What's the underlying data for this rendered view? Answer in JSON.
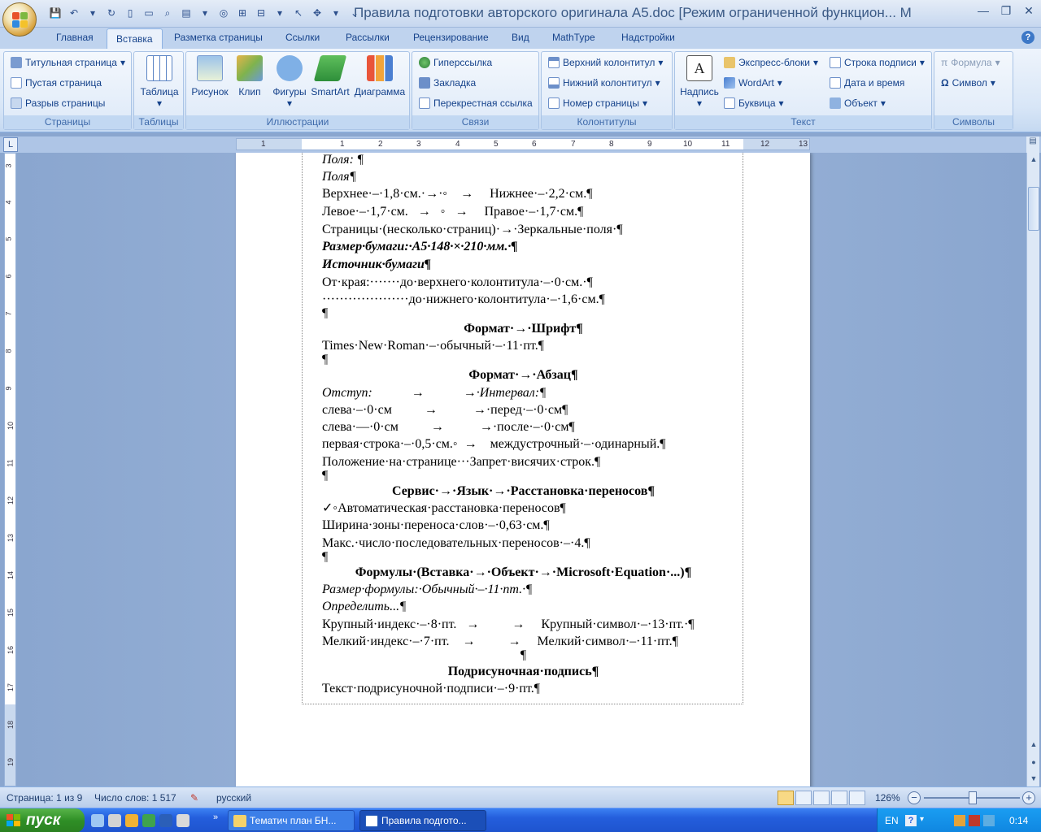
{
  "window": {
    "title": "Правила подготовки авторского оригинала A5.doc [Режим ограниченной функцион... M"
  },
  "tabs": [
    "Главная",
    "Вставка",
    "Разметка страницы",
    "Ссылки",
    "Рассылки",
    "Рецензирование",
    "Вид",
    "MathType",
    "Надстройки"
  ],
  "ribbon": {
    "pages": {
      "label": "Страницы",
      "items": [
        "Титульная страница",
        "Пустая страница",
        "Разрыв страницы"
      ]
    },
    "tables": {
      "label": "Таблицы",
      "table": "Таблица"
    },
    "illustrations": {
      "label": "Иллюстрации",
      "items": [
        "Рисунок",
        "Клип",
        "Фигуры",
        "SmartArt",
        "Диаграмма"
      ]
    },
    "links": {
      "label": "Связи",
      "items": [
        "Гиперссылка",
        "Закладка",
        "Перекрестная ссылка"
      ]
    },
    "header_footer": {
      "label": "Колонтитулы",
      "items": [
        "Верхний колонтитул",
        "Нижний колонтитул",
        "Номер страницы"
      ]
    },
    "text": {
      "label": "Текст",
      "textbox": "Надпись",
      "items": [
        "Экспресс-блоки",
        "WordArt",
        "Буквица",
        "Строка подписи",
        "Дата и время",
        "Объект"
      ]
    },
    "symbols": {
      "label": "Символы",
      "items": [
        "Формула",
        "Символ"
      ]
    }
  },
  "ruler_numbers": [
    "1",
    "1",
    "2",
    "3",
    "4",
    "5",
    "6",
    "7",
    "8",
    "9",
    "10",
    "11",
    "12",
    "13"
  ],
  "vruler_numbers": [
    "3",
    "4",
    "5",
    "6",
    "7",
    "8",
    "9",
    "10",
    "11",
    "12",
    "13",
    "14",
    "15",
    "16",
    "17",
    "18",
    "19"
  ],
  "document": {
    "lines": [
      "Поля: ¶",
      "Поля¶",
      "Верхнее·–·1,8·см.·→·◦    →     Нижнее·–·2,2·см.¶",
      "Левое·–·1,7·см.   →   ◦   →     Правое·–·1,7·см.¶",
      "Страницы·(несколько·страниц)·→·Зеркальные·поля·¶",
      "Размер·бумаги:·А5·148·×·210·мм.·¶",
      "Источник·бумаги¶",
      "От·края:·······до·верхнего·колонтитула·–·0·см.·¶",
      "····················до·нижнего·колонтитула·–·1,6·см.¶",
      "¶",
      "Формат·→·Шрифт¶",
      "Times·New·Roman·–·обычный·–·11·пт.¶",
      "¶",
      "Формат·→·Абзац¶",
      "Отступ:            →            →·Интервал:¶",
      "слева·–·0·см          →           →·перед·–·0·см¶",
      "слева·—·0·см          →           →·после·–·0·см¶",
      "первая·строка·–·0,5·см.◦  →    междустрочный·–·одинарный.¶",
      "Положение·на·странице···Запрет·висячих·строк.¶",
      "¶",
      "Сервис·→·Язык·→·Расстановка·переносов¶",
      "✓◦Автоматическая·расстановка·переносов¶",
      "Ширина·зоны·переноса·слов·–·0,63·см.¶",
      "Макс.·число·последовательных·переносов·–·4.¶",
      "¶",
      "Формулы·(Вставка·→·Объект·→·Microsoft·Equation·...)¶",
      "Размер·формулы:·Обычный·–·11·пт.·¶",
      "Определить...¶",
      "Крупный·индекс·–·8·пт.   →          →     Крупный·символ·–·13·пт.·¶",
      "Мелкий·индекс·–·7·пт.    →          →     Мелкий·символ·–·11·пт.¶",
      "¶",
      "Подрисуночная·подпись¶",
      "Текст·подрисуночной·подписи·–·9·пт.¶"
    ]
  },
  "status": {
    "page": "Страница: 1 из 9",
    "words": "Число слов: 1 517",
    "language": "русский",
    "zoom": "126%"
  },
  "taskbar": {
    "start": "пуск",
    "buttons": [
      "Тематич план БН...",
      "Правила подгото..."
    ],
    "lang": "EN",
    "time": "0:14"
  },
  "colors": {
    "accent": "#15428b",
    "taskbar": "#245edc",
    "start": "#2f8f26"
  }
}
